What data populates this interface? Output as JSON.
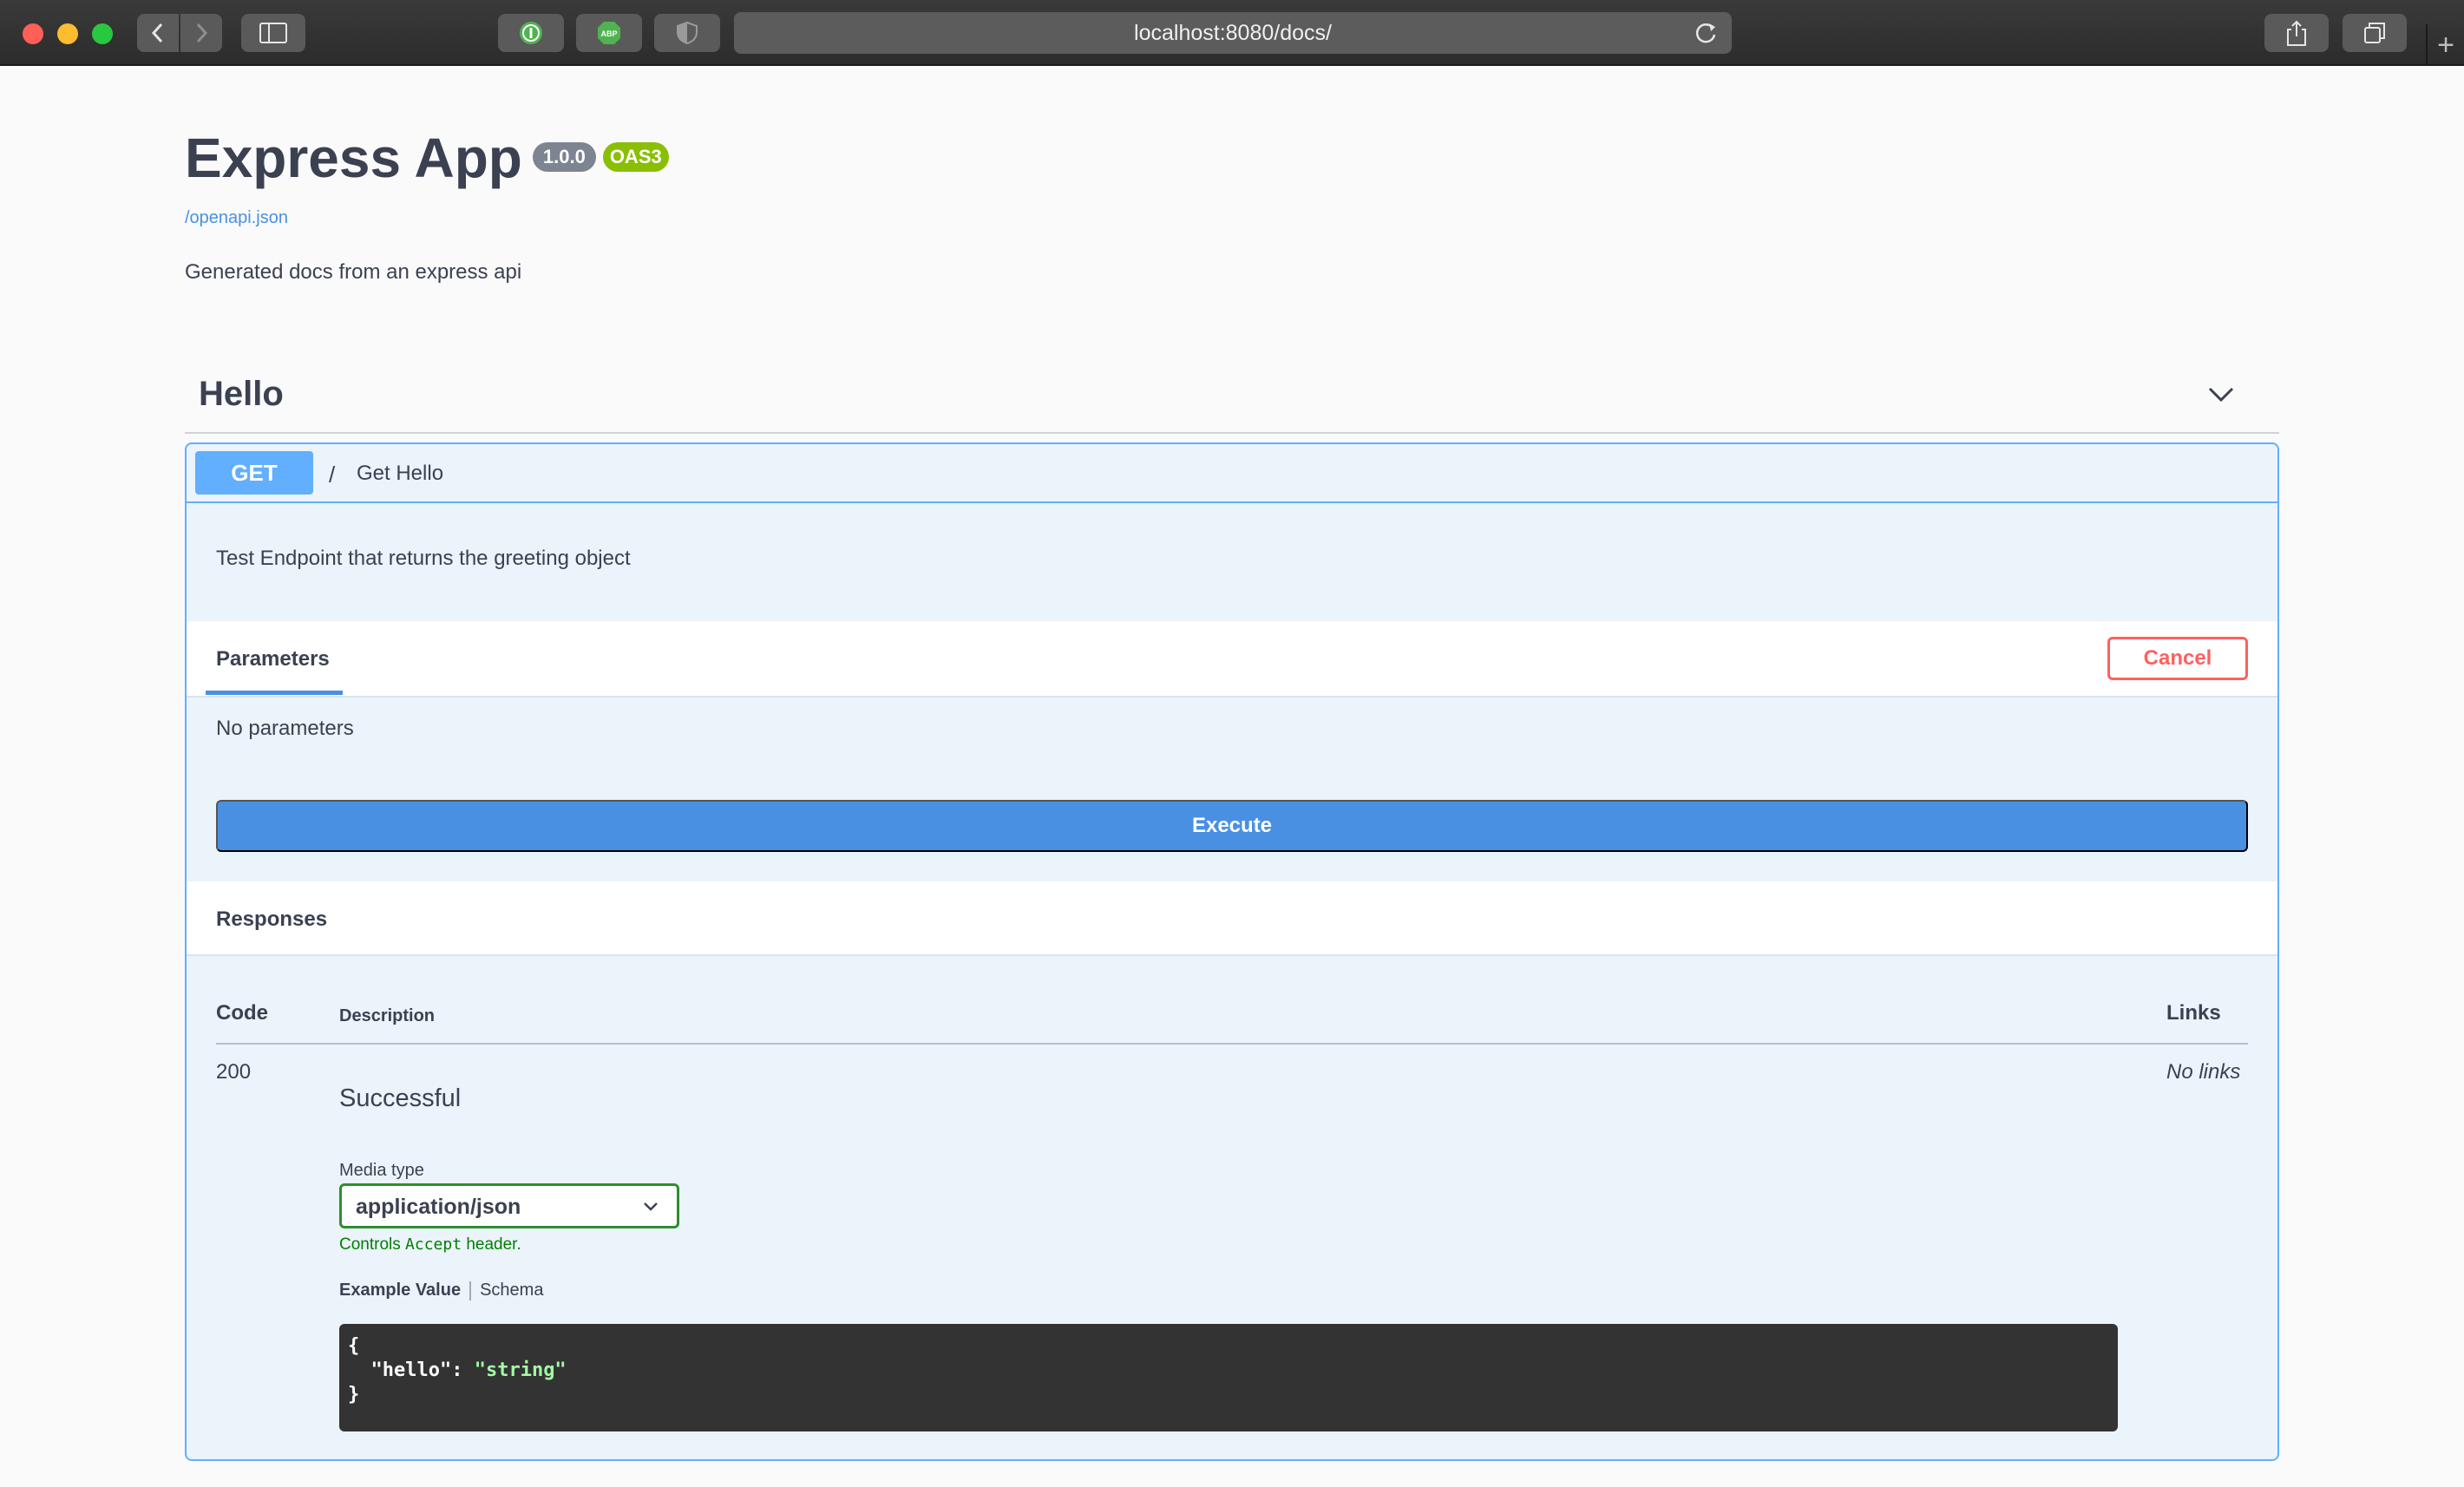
{
  "browser": {
    "url": "localhost:8080/docs/",
    "icons": [
      "back-icon",
      "forward-icon",
      "sidebar-icon",
      "onepassword-icon",
      "adblock-icon",
      "shield-icon",
      "reload-icon",
      "share-icon",
      "tabs-icon",
      "plus-icon"
    ]
  },
  "info": {
    "title": "Express App",
    "version": "1.0.0",
    "oas": "OAS3",
    "spec_link": "/openapi.json",
    "description": "Generated docs from an express api"
  },
  "tag": {
    "name": "Hello"
  },
  "operation": {
    "method": "GET",
    "path": "/",
    "summary": "Get Hello",
    "description": "Test Endpoint that returns the greeting object",
    "parameters_tab": "Parameters",
    "cancel_label": "Cancel",
    "no_parameters": "No parameters",
    "execute_label": "Execute",
    "responses_title": "Responses",
    "columns": {
      "code": "Code",
      "description": "Description",
      "links": "Links"
    },
    "responses": [
      {
        "code": "200",
        "description": "Successful",
        "links": "No links",
        "media_type_label": "Media type",
        "media_type": "application/json",
        "hint_prefix": "Controls",
        "hint_code": "Accept",
        "hint_suffix": "header.",
        "example_tab": "Example Value",
        "schema_tab": "Schema",
        "example": {
          "open": "{",
          "key": "\"hello\"",
          "colon": ": ",
          "value": "\"string\"",
          "close": "}"
        }
      }
    ]
  },
  "colors": {
    "get_accent": "#61affe",
    "execute": "#4990e2",
    "cancel": "#ff6060",
    "oas_badge": "#89bf04",
    "version_badge": "#7d8492",
    "select_border": "#2d8f2d"
  }
}
